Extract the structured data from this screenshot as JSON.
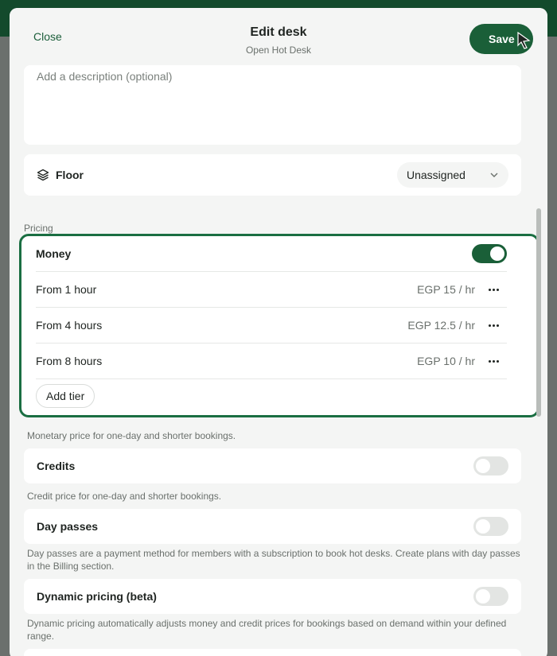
{
  "header": {
    "close_label": "Close",
    "title": "Edit desk",
    "subtitle": "Open Hot Desk",
    "save_label": "Save"
  },
  "description": {
    "placeholder": "Add a description (optional)"
  },
  "floor": {
    "label": "Floor",
    "value": "Unassigned"
  },
  "pricing": {
    "section_label": "Pricing",
    "money": {
      "label": "Money",
      "enabled": true,
      "tiers": [
        {
          "label": "From 1 hour",
          "price": "EGP 15 / hr"
        },
        {
          "label": "From 4 hours",
          "price": "EGP 12.5 / hr"
        },
        {
          "label": "From 8 hours",
          "price": "EGP 10 / hr"
        }
      ],
      "add_tier_label": "Add tier",
      "help": "Monetary price for one-day and shorter bookings."
    },
    "credits": {
      "label": "Credits",
      "enabled": false,
      "help": "Credit price for one-day and shorter bookings."
    },
    "day_passes": {
      "label": "Day passes",
      "enabled": false,
      "help": "Day passes are a payment method for members with a subscription to book hot desks. Create plans with day passes in the Billing section."
    },
    "dynamic": {
      "label": "Dynamic pricing (beta)",
      "enabled": false,
      "help": "Dynamic pricing automatically adjusts money and credit prices for bookings based on demand within your defined range."
    }
  },
  "colors": {
    "accent": "#1a5f38",
    "highlight_border": "#1a6e42",
    "background": "#f4f5f4"
  }
}
